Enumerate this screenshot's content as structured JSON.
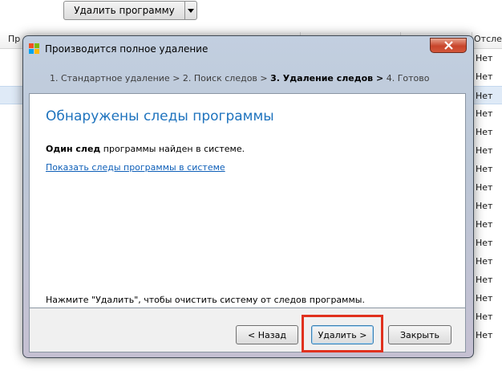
{
  "toolbar": {
    "uninstall_label": "Удалить программу"
  },
  "list": {
    "columns": [
      "Пр",
      "Отслеж"
    ],
    "rows_value": "Нет",
    "row_count": 16
  },
  "dialog": {
    "title": "Производится полное удаление",
    "steps": {
      "s1": "1. Стандартное удаление >",
      "s2": "2. Поиск следов >",
      "s3": "3. Удаление следов >",
      "s4": "4. Готово"
    },
    "heading": "Обнаружены следы программы",
    "found_bold": "Один след",
    "found_rest": " программы найден в системе.",
    "show_link": "Показать следы программы в системе",
    "hint": "Нажмите \"Удалить\", чтобы очистить систему от следов программы.",
    "buttons": {
      "back": "< Назад",
      "delete": "Удалить >",
      "close": "Закрыть"
    }
  },
  "colors": {
    "heading": "#1e73be",
    "link": "#0e5fb8",
    "highlight": "#e0311e"
  }
}
